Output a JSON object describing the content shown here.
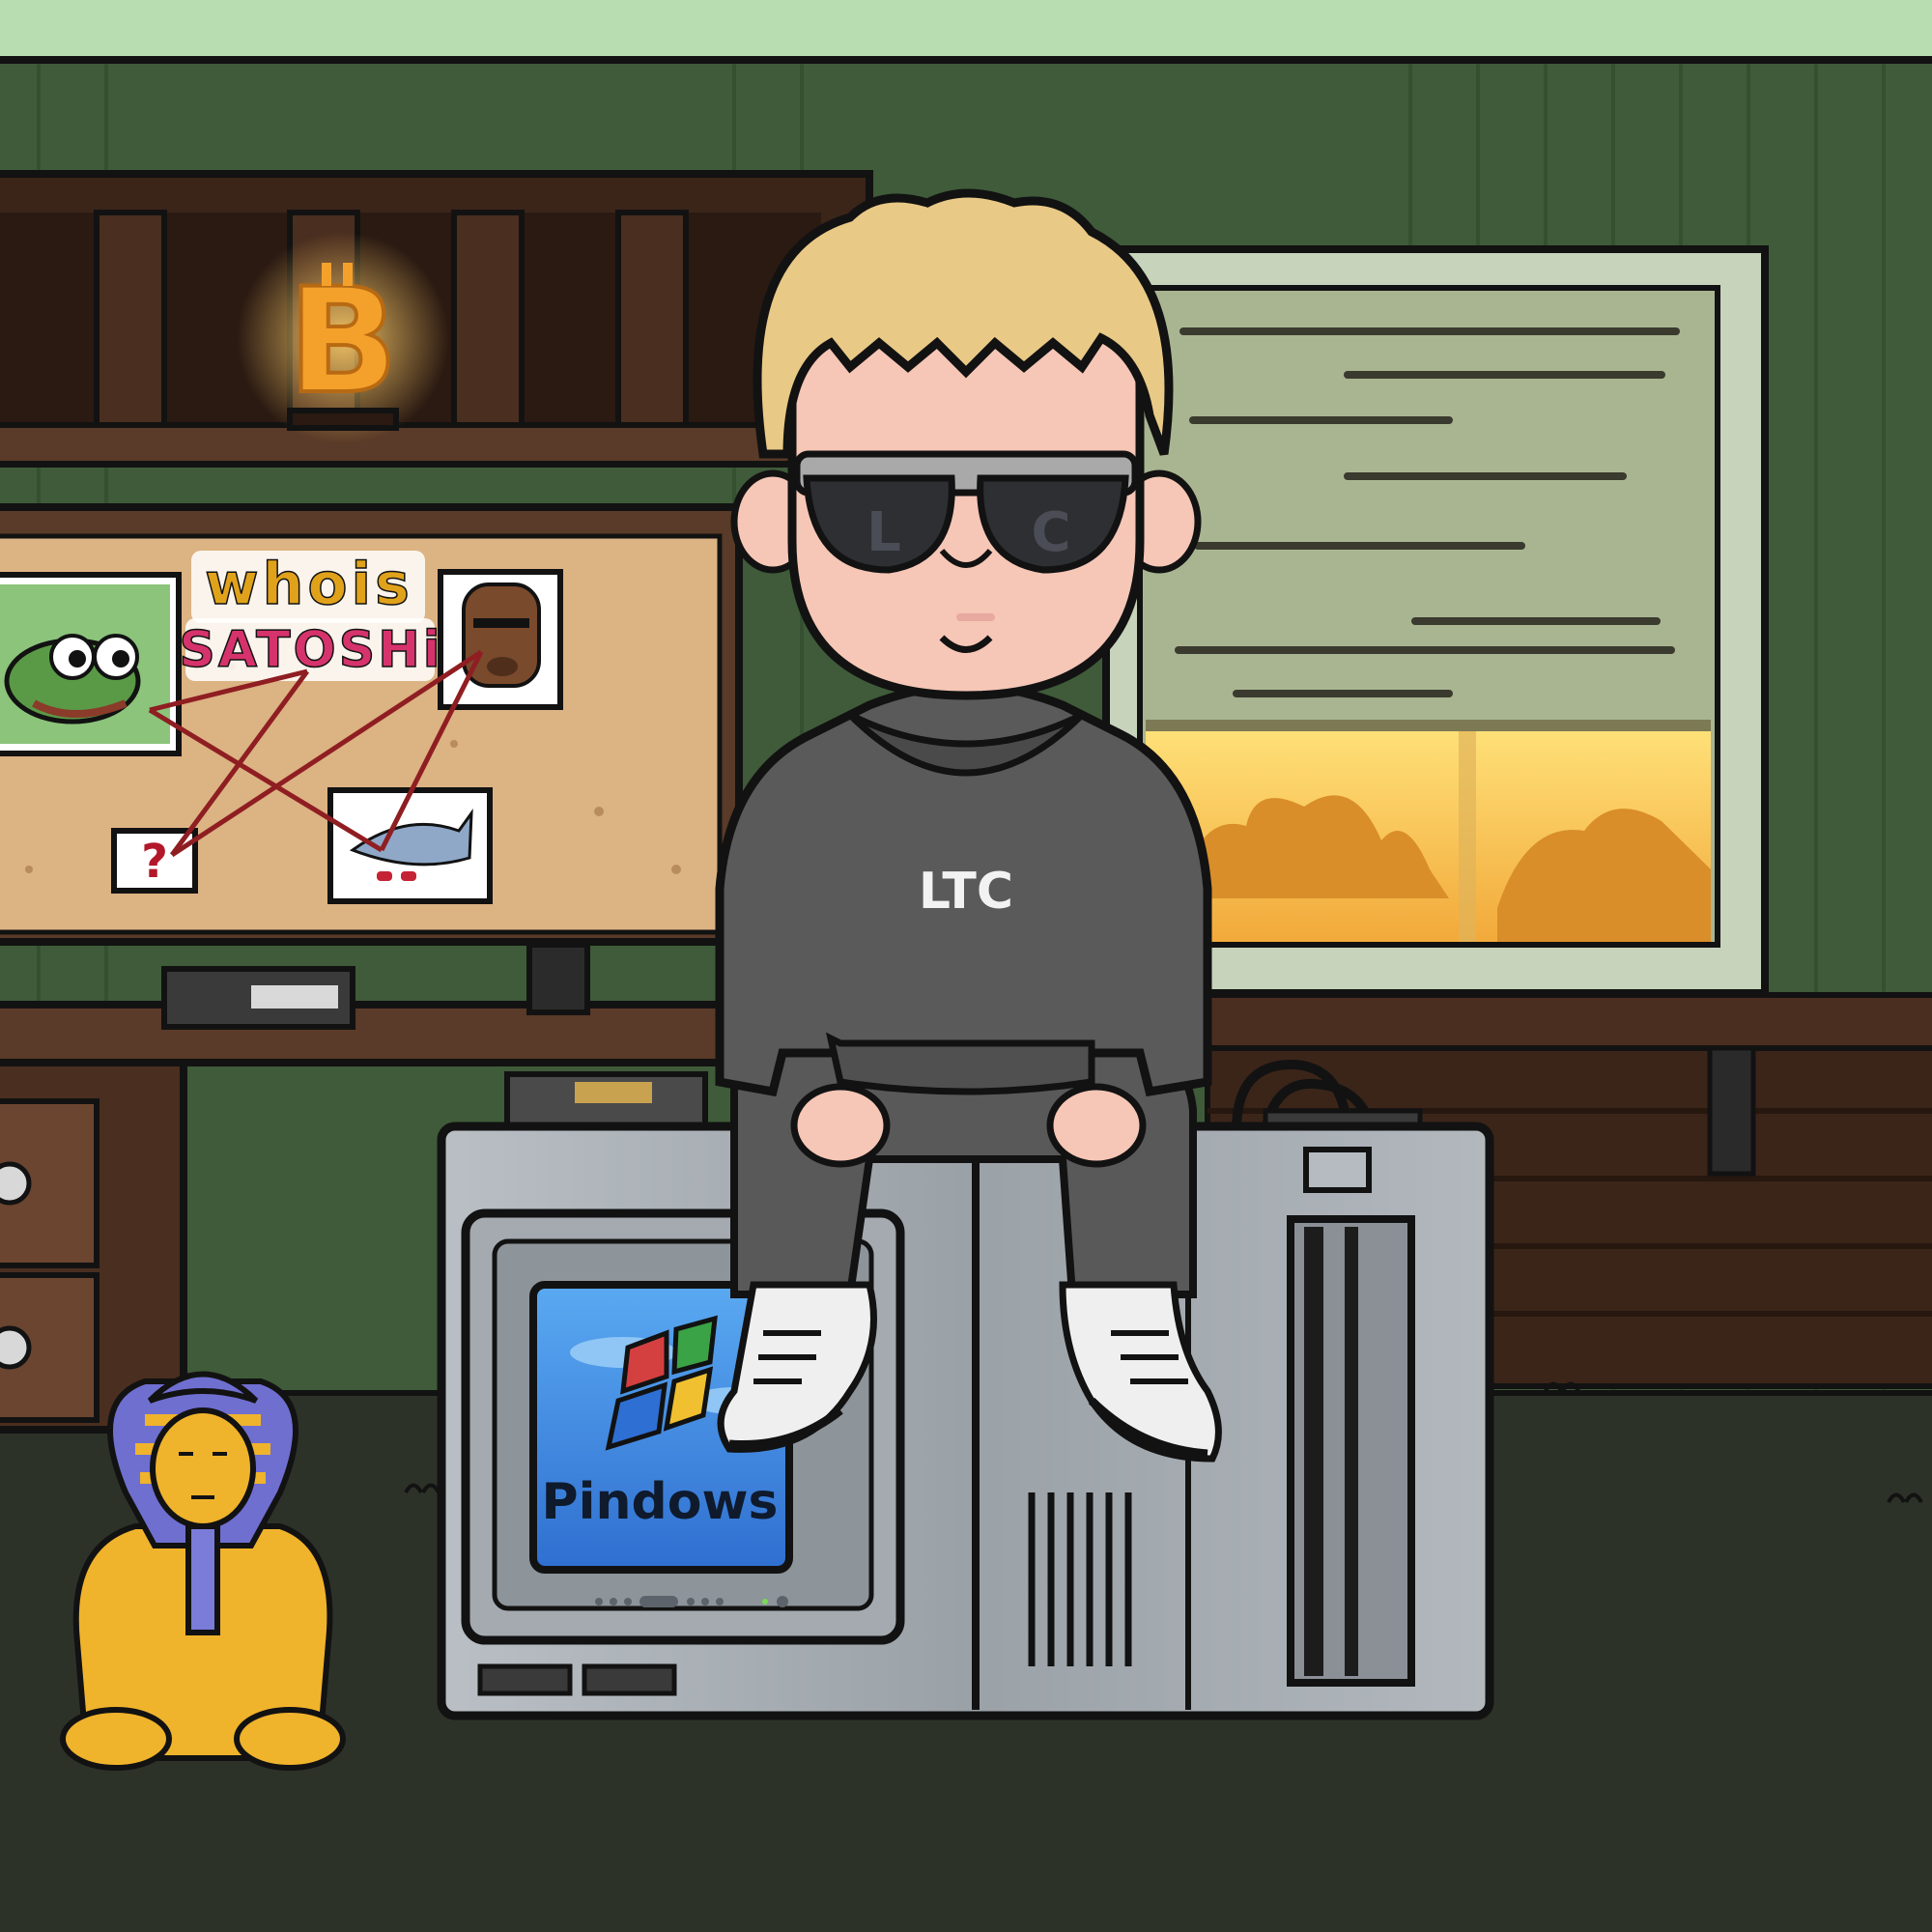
{
  "scene": {
    "hoodie_text": "LTC",
    "glasses_left": "L",
    "glasses_right": "C",
    "poster_title_line1": "whois",
    "poster_title_line2": "SATOSHi",
    "question_mark": "?",
    "monitor_brand": "Pindows",
    "shelf_logo": "B"
  },
  "colors": {
    "wall": "#3f5b39",
    "wall_stripe": "#355031",
    "ceiling": "#b8ddb0",
    "wood_dark": "#3b2519",
    "wood_mid": "#5a3a28",
    "cork": "#dcb383",
    "floor": "#2d3229",
    "hoodie": "#5a5a5a",
    "skin": "#f6c6b6",
    "hair": "#e9c986",
    "metal": "#a7adb2",
    "screen": "#3b86dc",
    "sunset": "#f5c33c",
    "gold": "#f0b32c",
    "red_string": "#8f1e22",
    "outline": "#121212"
  }
}
